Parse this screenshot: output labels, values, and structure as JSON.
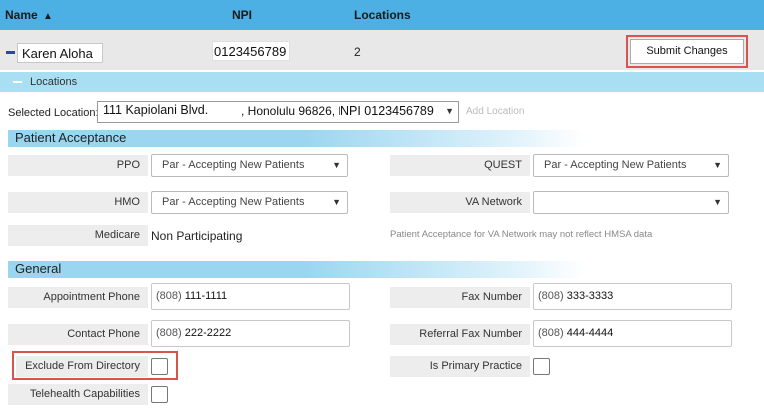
{
  "header": {
    "col_name": "Name",
    "col_npi": "NPI",
    "col_locations": "Locations",
    "sort_glyph": "▲"
  },
  "provider": {
    "name": "Karen Aloha",
    "npi": "0123456789",
    "npi_trail": "‹",
    "locations_count": "2",
    "submit_label": "Submit Changes"
  },
  "locations_bar": {
    "label": "Locations"
  },
  "selected_location": {
    "label": "Selected Location:",
    "address": "111 Kapiolani Blvd.",
    "city": ", Honolulu 96826, HI",
    "npi": "NPI 0123456789",
    "add_label": "Add Location"
  },
  "patient_acceptance": {
    "title": "Patient Acceptance",
    "ppo": {
      "label": "PPO",
      "value": "Par - Accepting New Patients"
    },
    "quest": {
      "label": "QUEST",
      "value": "Par - Accepting New Patients"
    },
    "hmo": {
      "label": "HMO",
      "value": "Par - Accepting New Patients"
    },
    "va": {
      "label": "VA Network",
      "value": ""
    },
    "medicare": {
      "label": "Medicare",
      "value": "Non Participating"
    },
    "va_note": "Patient Acceptance for VA Network may not reflect HMSA data"
  },
  "general": {
    "title": "General",
    "appt_phone": {
      "label": "Appointment Phone",
      "area": "(808)",
      "number": "111-1111"
    },
    "fax": {
      "label": "Fax Number",
      "area": "(808)",
      "number": "333-3333"
    },
    "contact_phone": {
      "label": "Contact Phone",
      "area": "(808)",
      "number": "222-2222"
    },
    "referral_fax": {
      "label": "Referral Fax Number",
      "area": "(808)",
      "number": "444-4444"
    },
    "exclude_dir": {
      "label": "Exclude From Directory"
    },
    "primary_practice": {
      "label": "Is Primary Practice"
    },
    "telehealth": {
      "label": "Telehealth Capabilities"
    }
  },
  "icons": {
    "collapse": "minus-icon",
    "dropdown": "chevron-down-icon"
  }
}
